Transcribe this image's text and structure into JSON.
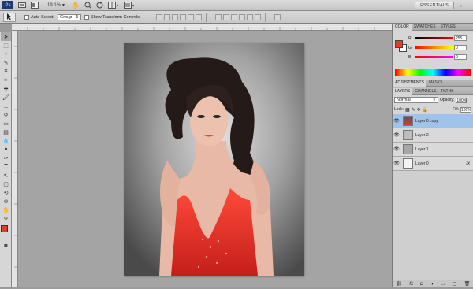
{
  "app": {
    "logo": "Ps",
    "zoom": "19.1%",
    "workspace": "ESSENTIALS"
  },
  "options": {
    "auto_select_label": "Auto-Select:",
    "auto_select_value": "Group",
    "transform_label": "Show Transform Controls"
  },
  "panels": {
    "color_tabs": [
      "COLOR",
      "SWATCHES",
      "STYLES"
    ],
    "color": {
      "r_label": "R",
      "g_label": "G",
      "b_label": "B",
      "r": "255",
      "g": "0",
      "b": "0"
    },
    "adjust_tabs": [
      "ADJUSTMENTS",
      "MASKS"
    ],
    "layer_tabs": [
      "LAYERS",
      "CHANNELS",
      "PATHS"
    ],
    "blend_mode": "Normal",
    "opacity_label": "Opacity:",
    "opacity": "100%",
    "lock_label": "Lock:",
    "fill_label": "Fill:",
    "fill": "100%",
    "layers": [
      {
        "name": "Layer 0 copy",
        "active": true
      },
      {
        "name": "Layer 2",
        "active": false
      },
      {
        "name": "Layer 1",
        "active": false
      },
      {
        "name": "Layer 0",
        "active": false,
        "fx": "fx"
      }
    ]
  },
  "colors": {
    "foreground": "#e83b22",
    "selection": "#9fc3ea"
  }
}
